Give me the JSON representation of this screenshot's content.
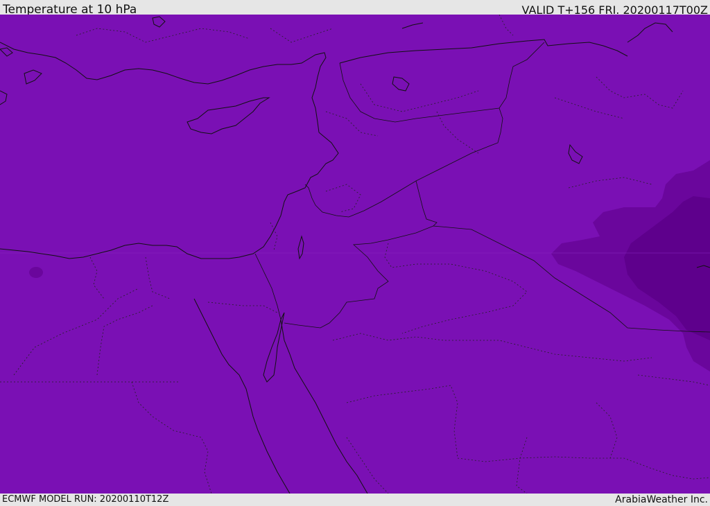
{
  "header": {
    "title": "Temperature at 10 hPa",
    "valid": "VALID T+156 FRI. 20200117T00Z"
  },
  "footer": {
    "model_run": "ECMWF MODEL RUN: 20200110T12Z",
    "credit": "ArabiaWeather Inc."
  },
  "map": {
    "region": "Eastern Mediterranean / Middle East",
    "fill_colors": {
      "background": "#7a10b4",
      "darker_band": "#6a069c",
      "darkest_band": "#5e008c",
      "coastline": "#111111"
    }
  }
}
